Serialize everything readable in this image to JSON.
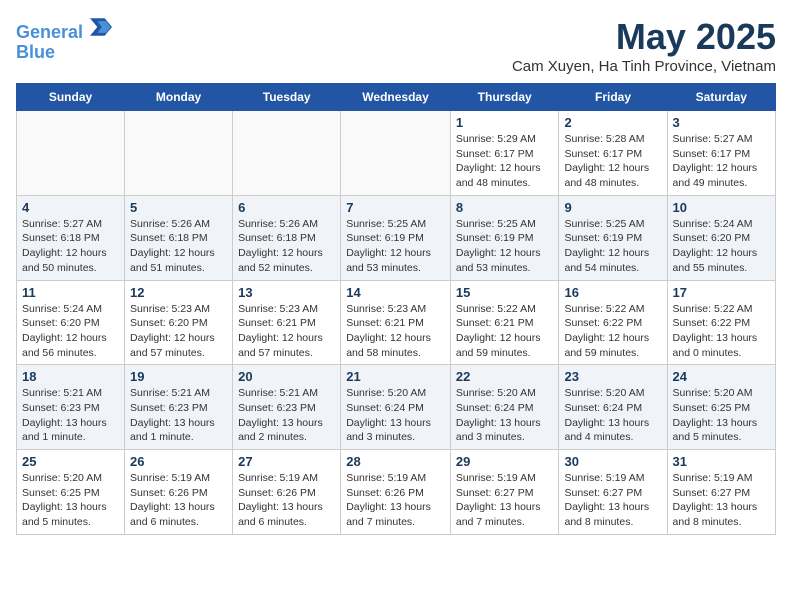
{
  "header": {
    "logo_line1": "General",
    "logo_line2": "Blue",
    "month": "May 2025",
    "location": "Cam Xuyen, Ha Tinh Province, Vietnam"
  },
  "weekdays": [
    "Sunday",
    "Monday",
    "Tuesday",
    "Wednesday",
    "Thursday",
    "Friday",
    "Saturday"
  ],
  "weeks": [
    [
      {
        "day": "",
        "info": ""
      },
      {
        "day": "",
        "info": ""
      },
      {
        "day": "",
        "info": ""
      },
      {
        "day": "",
        "info": ""
      },
      {
        "day": "1",
        "info": "Sunrise: 5:29 AM\nSunset: 6:17 PM\nDaylight: 12 hours\nand 48 minutes."
      },
      {
        "day": "2",
        "info": "Sunrise: 5:28 AM\nSunset: 6:17 PM\nDaylight: 12 hours\nand 48 minutes."
      },
      {
        "day": "3",
        "info": "Sunrise: 5:27 AM\nSunset: 6:17 PM\nDaylight: 12 hours\nand 49 minutes."
      }
    ],
    [
      {
        "day": "4",
        "info": "Sunrise: 5:27 AM\nSunset: 6:18 PM\nDaylight: 12 hours\nand 50 minutes."
      },
      {
        "day": "5",
        "info": "Sunrise: 5:26 AM\nSunset: 6:18 PM\nDaylight: 12 hours\nand 51 minutes."
      },
      {
        "day": "6",
        "info": "Sunrise: 5:26 AM\nSunset: 6:18 PM\nDaylight: 12 hours\nand 52 minutes."
      },
      {
        "day": "7",
        "info": "Sunrise: 5:25 AM\nSunset: 6:19 PM\nDaylight: 12 hours\nand 53 minutes."
      },
      {
        "day": "8",
        "info": "Sunrise: 5:25 AM\nSunset: 6:19 PM\nDaylight: 12 hours\nand 53 minutes."
      },
      {
        "day": "9",
        "info": "Sunrise: 5:25 AM\nSunset: 6:19 PM\nDaylight: 12 hours\nand 54 minutes."
      },
      {
        "day": "10",
        "info": "Sunrise: 5:24 AM\nSunset: 6:20 PM\nDaylight: 12 hours\nand 55 minutes."
      }
    ],
    [
      {
        "day": "11",
        "info": "Sunrise: 5:24 AM\nSunset: 6:20 PM\nDaylight: 12 hours\nand 56 minutes."
      },
      {
        "day": "12",
        "info": "Sunrise: 5:23 AM\nSunset: 6:20 PM\nDaylight: 12 hours\nand 57 minutes."
      },
      {
        "day": "13",
        "info": "Sunrise: 5:23 AM\nSunset: 6:21 PM\nDaylight: 12 hours\nand 57 minutes."
      },
      {
        "day": "14",
        "info": "Sunrise: 5:23 AM\nSunset: 6:21 PM\nDaylight: 12 hours\nand 58 minutes."
      },
      {
        "day": "15",
        "info": "Sunrise: 5:22 AM\nSunset: 6:21 PM\nDaylight: 12 hours\nand 59 minutes."
      },
      {
        "day": "16",
        "info": "Sunrise: 5:22 AM\nSunset: 6:22 PM\nDaylight: 12 hours\nand 59 minutes."
      },
      {
        "day": "17",
        "info": "Sunrise: 5:22 AM\nSunset: 6:22 PM\nDaylight: 13 hours\nand 0 minutes."
      }
    ],
    [
      {
        "day": "18",
        "info": "Sunrise: 5:21 AM\nSunset: 6:23 PM\nDaylight: 13 hours\nand 1 minute."
      },
      {
        "day": "19",
        "info": "Sunrise: 5:21 AM\nSunset: 6:23 PM\nDaylight: 13 hours\nand 1 minute."
      },
      {
        "day": "20",
        "info": "Sunrise: 5:21 AM\nSunset: 6:23 PM\nDaylight: 13 hours\nand 2 minutes."
      },
      {
        "day": "21",
        "info": "Sunrise: 5:20 AM\nSunset: 6:24 PM\nDaylight: 13 hours\nand 3 minutes."
      },
      {
        "day": "22",
        "info": "Sunrise: 5:20 AM\nSunset: 6:24 PM\nDaylight: 13 hours\nand 3 minutes."
      },
      {
        "day": "23",
        "info": "Sunrise: 5:20 AM\nSunset: 6:24 PM\nDaylight: 13 hours\nand 4 minutes."
      },
      {
        "day": "24",
        "info": "Sunrise: 5:20 AM\nSunset: 6:25 PM\nDaylight: 13 hours\nand 5 minutes."
      }
    ],
    [
      {
        "day": "25",
        "info": "Sunrise: 5:20 AM\nSunset: 6:25 PM\nDaylight: 13 hours\nand 5 minutes."
      },
      {
        "day": "26",
        "info": "Sunrise: 5:19 AM\nSunset: 6:26 PM\nDaylight: 13 hours\nand 6 minutes."
      },
      {
        "day": "27",
        "info": "Sunrise: 5:19 AM\nSunset: 6:26 PM\nDaylight: 13 hours\nand 6 minutes."
      },
      {
        "day": "28",
        "info": "Sunrise: 5:19 AM\nSunset: 6:26 PM\nDaylight: 13 hours\nand 7 minutes."
      },
      {
        "day": "29",
        "info": "Sunrise: 5:19 AM\nSunset: 6:27 PM\nDaylight: 13 hours\nand 7 minutes."
      },
      {
        "day": "30",
        "info": "Sunrise: 5:19 AM\nSunset: 6:27 PM\nDaylight: 13 hours\nand 8 minutes."
      },
      {
        "day": "31",
        "info": "Sunrise: 5:19 AM\nSunset: 6:27 PM\nDaylight: 13 hours\nand 8 minutes."
      }
    ]
  ]
}
